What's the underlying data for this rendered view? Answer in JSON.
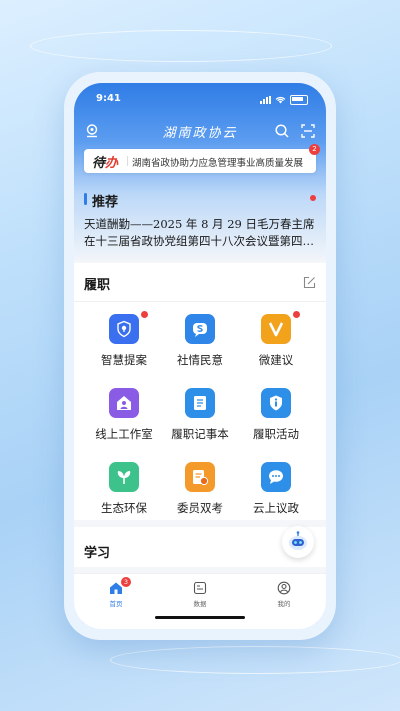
{
  "status_bar": {
    "time": "9:41"
  },
  "header": {
    "app_logo_text": "湖南政协云"
  },
  "todo": {
    "label_prefix": "待",
    "label_suffix": "办",
    "text": "湖南省政协助力应急管理事业高质量发展",
    "badge_count": "2"
  },
  "recommend": {
    "title": "推荐",
    "headline_line1": "天道酬勤——2025 年 8 月 29 日毛万春主席",
    "headline_line2": "在十三届省政协党组第四十八次会议暨第四十七次主席会议上的讲话"
  },
  "duties": {
    "title": "履职",
    "items": [
      {
        "label": "智慧提案",
        "icon": "bulb-shield-icon",
        "color": "#3a6ff0",
        "has_dot": true
      },
      {
        "label": "社情民意",
        "icon": "chat-s-icon",
        "color": "#2f86e8",
        "has_dot": false
      },
      {
        "label": "微建议",
        "icon": "v-letter-icon",
        "color": "#f2a21b",
        "has_dot": true
      },
      {
        "label": "线上工作室",
        "icon": "house-person-icon",
        "color": "#8a5ce6",
        "has_dot": false
      },
      {
        "label": "履职记事本",
        "icon": "notebook-icon",
        "color": "#2d8fe8",
        "has_dot": false
      },
      {
        "label": "履职活动",
        "icon": "info-badge-icon",
        "color": "#2d8fe8",
        "has_dot": false
      },
      {
        "label": "生态环保",
        "icon": "leaf-icon",
        "color": "#3cc28a",
        "has_dot": false
      },
      {
        "label": "委员双考",
        "icon": "exam-icon",
        "color": "#f39a2b",
        "has_dot": false
      },
      {
        "label": "云上议政",
        "icon": "chat-bubble-icon",
        "color": "#2d8fe8",
        "has_dot": false
      }
    ]
  },
  "study": {
    "title": "学习"
  },
  "tabbar": {
    "tabs": [
      {
        "label": "首页",
        "active": true,
        "badge": "3"
      },
      {
        "label": "数据",
        "active": false
      },
      {
        "label": "我的",
        "active": false
      }
    ]
  },
  "colors": {
    "primary": "#2f7de6",
    "badge_red": "#ee3f3f"
  }
}
